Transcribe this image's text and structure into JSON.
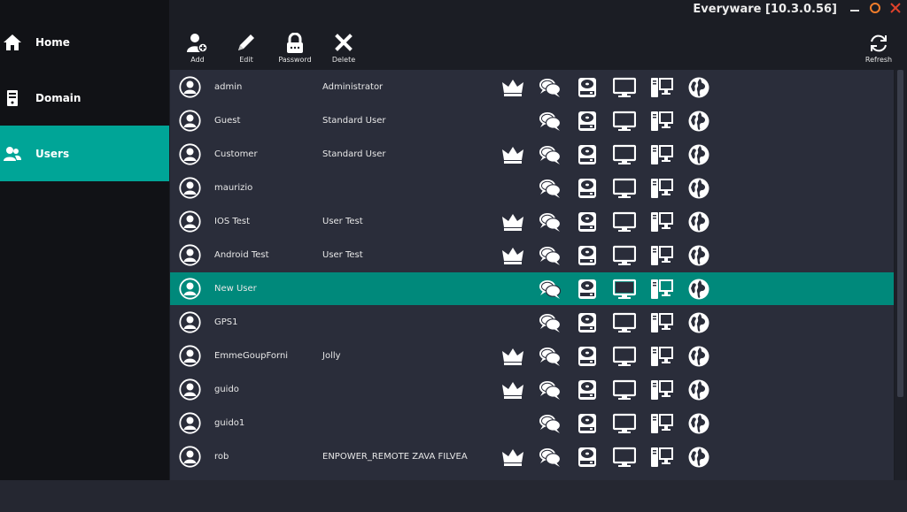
{
  "window": {
    "title": "Everyware [10.3.0.56]",
    "accent": "#00a597",
    "close_color": "#e0412b",
    "restore_color": "#f07d2b"
  },
  "sidebar": {
    "items": [
      {
        "label": "Home",
        "icon": "home-icon",
        "active": false
      },
      {
        "label": "Domain",
        "icon": "server-icon",
        "active": false
      },
      {
        "label": "Users",
        "icon": "users-icon",
        "active": true
      }
    ]
  },
  "toolbar": {
    "add_label": "Add",
    "edit_label": "Edit",
    "password_label": "Password",
    "delete_label": "Delete",
    "refresh_label": "Refresh"
  },
  "users": [
    {
      "name": "admin",
      "role": "Administrator",
      "crown": true,
      "selected": false
    },
    {
      "name": "Guest",
      "role": "Standard User",
      "crown": false,
      "selected": false
    },
    {
      "name": "Customer",
      "role": "Standard User",
      "crown": true,
      "selected": false
    },
    {
      "name": "maurizio",
      "role": "",
      "crown": false,
      "selected": false
    },
    {
      "name": "IOS Test",
      "role": "User Test",
      "crown": true,
      "selected": false
    },
    {
      "name": "Android Test",
      "role": "User Test",
      "crown": true,
      "selected": false
    },
    {
      "name": "New User",
      "role": "",
      "crown": false,
      "selected": true
    },
    {
      "name": "GPS1",
      "role": "",
      "crown": false,
      "selected": false
    },
    {
      "name": "EmmeGoupForni",
      "role": "Jolly",
      "crown": true,
      "selected": false
    },
    {
      "name": "guido",
      "role": "",
      "crown": true,
      "selected": false
    },
    {
      "name": "guido1",
      "role": "",
      "crown": false,
      "selected": false
    },
    {
      "name": "rob",
      "role": "ENPOWER_REMOTE ZAVA FILVEA",
      "crown": true,
      "selected": false
    }
  ],
  "row_icons": [
    "chat-icon",
    "disk-icon",
    "monitor-icon",
    "desktop-pc-icon",
    "globe-icon"
  ]
}
